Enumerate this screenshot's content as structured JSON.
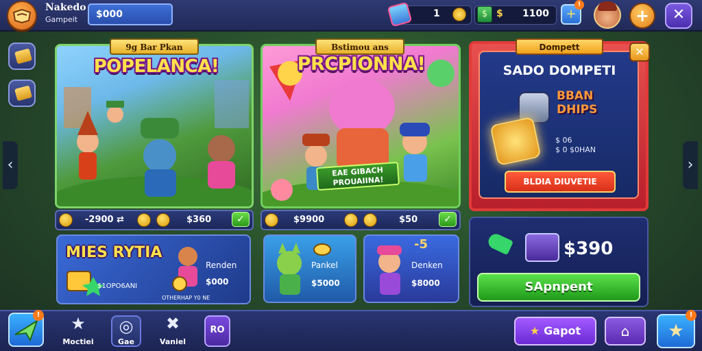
{
  "header": {
    "player_name": "Nakedo",
    "player_sub": "Gampeit",
    "coin_pill": "$000",
    "resource_1": {
      "value": "1",
      "icon": "gem-icon"
    },
    "resource_2": {
      "symbol": "$",
      "value": "1100",
      "icon": "cash-icon"
    },
    "add_button": "+",
    "badge": "!",
    "plus_button": "+",
    "close_button": "✕"
  },
  "panels": [
    {
      "ribbon": "9g Bar Pkan",
      "headline": "POPELANCA!",
      "strip": {
        "left": "-2900 ⇄",
        "right": "$360",
        "check": "✓"
      },
      "card": {
        "title": "MIES RYTIA",
        "label": "Renden",
        "price": "$000",
        "note": "$1OPO6ANI",
        "footer": "OTHERHAP Y0 NE"
      }
    },
    {
      "ribbon": "Bstimou ans",
      "headline": "PRCPIONNA!",
      "banner": "EAE GIBACH PROUAIINA!",
      "strip": {
        "left": "$9900",
        "right": "$50",
        "check": "✓"
      },
      "cards": [
        {
          "label": "Pankel",
          "price": "$5000"
        },
        {
          "label": "Denken",
          "price": "$8000",
          "deco": "-5"
        }
      ]
    },
    {
      "ribbon": "Dompett",
      "title": "SADO DOMPETI",
      "subtitle": "BBAN DHIPS",
      "stats": [
        "$ 06",
        "$ 0 $0HAN"
      ],
      "cta": "BLDIA DIUVETIE",
      "close": "✕",
      "offer": {
        "price": "$390",
        "button": "SApnpent"
      }
    }
  ],
  "nav": {
    "left_arrow": "‹",
    "right_arrow": "›",
    "items": [
      {
        "label": "Moctiei",
        "icon": "★"
      },
      {
        "label": "Gae",
        "icon": "◎"
      },
      {
        "label": "Vaniel",
        "icon": "✖"
      }
    ],
    "quest_label": "RO",
    "cancel_label": "Gapot",
    "cancel_icon": "★",
    "hat_icon": "⌂",
    "fav_icon": "★"
  },
  "colors": {
    "top_bar": "#2f3a73",
    "accent_green": "#5ae04a",
    "accent_red": "#e23a3a",
    "accent_gold": "#ffe14a",
    "accent_purple": "#7a5ae0"
  }
}
